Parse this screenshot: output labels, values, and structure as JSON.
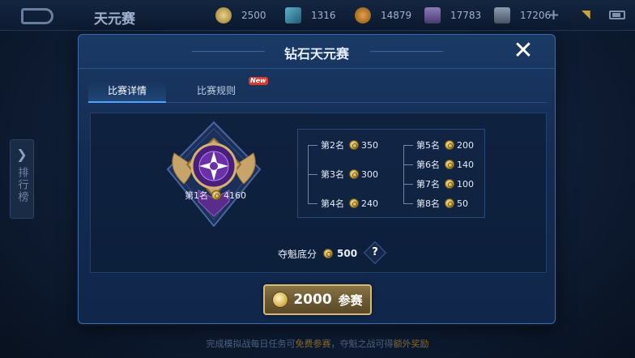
{
  "topbar": {
    "title": "天元赛",
    "currencies": [
      {
        "icon": "gold-coin-icon",
        "value": "2500"
      },
      {
        "icon": "diamond-cube-icon",
        "value": "1316"
      },
      {
        "icon": "points-coupon-icon",
        "value": "14879"
      },
      {
        "icon": "chest-icon",
        "value": "17783"
      },
      {
        "icon": "ticket-icon",
        "value": "17206"
      }
    ]
  },
  "sidebar": {
    "leaderboard_label": "排行榜"
  },
  "modal": {
    "title": "钻石天元赛",
    "tabs": [
      {
        "label": "比赛详情",
        "active": true
      },
      {
        "label": "比赛规则",
        "badge": "New"
      }
    ],
    "first_place": {
      "rank": "第1名",
      "reward": "4160"
    },
    "prizes_left": [
      {
        "rank": "第2名",
        "reward": "350"
      },
      {
        "rank": "第3名",
        "reward": "300"
      },
      {
        "rank": "第4名",
        "reward": "240"
      }
    ],
    "prizes_right": [
      {
        "rank": "第5名",
        "reward": "200"
      },
      {
        "rank": "第6名",
        "reward": "140"
      },
      {
        "rank": "第7名",
        "reward": "100"
      },
      {
        "rank": "第8名",
        "reward": "50"
      }
    ],
    "champion_base_label": "夺魁底分",
    "champion_base_value": "500",
    "help_symbol": "?",
    "join_button": {
      "cost": "2000",
      "label": "参赛"
    }
  },
  "footer": {
    "tip_part1": "完成模拟战每日任务可",
    "tip_hl1": "免费参赛",
    "tip_part2": "，夺魁之战可得",
    "tip_hl2": "额外奖励"
  },
  "colors": {
    "accent_blue": "#4fa3ff",
    "gold": "#d6bb78",
    "new_badge": "#d93a2f"
  }
}
